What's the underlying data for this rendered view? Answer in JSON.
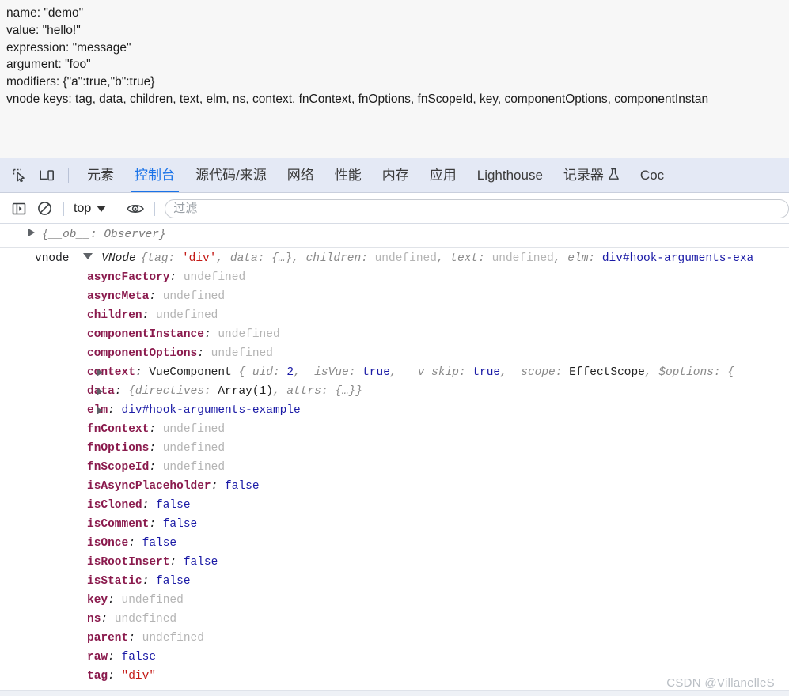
{
  "page_output": {
    "lines": [
      "name: \"demo\"",
      "value: \"hello!\"",
      "expression: \"message\"",
      "argument: \"foo\"",
      "modifiers: {\"a\":true,\"b\":true}",
      "vnode keys: tag, data, children, text, elm, ns, context, fnContext, fnOptions, fnScopeId, key, componentOptions, componentInstan"
    ]
  },
  "devtools": {
    "tabs": [
      {
        "label": "元素",
        "active": false
      },
      {
        "label": "控制台",
        "active": true
      },
      {
        "label": "源代码/来源",
        "active": false
      },
      {
        "label": "网络",
        "active": false
      },
      {
        "label": "性能",
        "active": false
      },
      {
        "label": "内存",
        "active": false
      },
      {
        "label": "应用",
        "active": false
      },
      {
        "label": "Lighthouse",
        "active": false
      },
      {
        "label": "记录器",
        "active": false,
        "has_flask": true
      },
      {
        "label": "Coc",
        "active": false
      }
    ],
    "console_toolbar": {
      "context_label": "top",
      "filter_placeholder": "过滤"
    },
    "console": {
      "observer_row": {
        "text": "{__ob__: Observer}"
      },
      "vnode_row": {
        "label": "vnode",
        "class_name": "VNode",
        "preview_parts": [
          {
            "text": "{tag: ",
            "kind": "preview"
          },
          {
            "text": "'div'",
            "kind": "string"
          },
          {
            "text": ", data: {…}, children: ",
            "kind": "preview"
          },
          {
            "text": "undefined",
            "kind": "undefined"
          },
          {
            "text": ", text: ",
            "kind": "preview"
          },
          {
            "text": "undefined",
            "kind": "undefined"
          },
          {
            "text": ", elm: ",
            "kind": "preview"
          },
          {
            "text": "div#hook-arguments-exa",
            "kind": "dom"
          }
        ]
      },
      "properties": [
        {
          "name": "asyncFactory",
          "expandable": false,
          "parts": [
            {
              "text": "undefined",
              "kind": "undefined"
            }
          ]
        },
        {
          "name": "asyncMeta",
          "expandable": false,
          "parts": [
            {
              "text": "undefined",
              "kind": "undefined"
            }
          ]
        },
        {
          "name": "children",
          "expandable": false,
          "parts": [
            {
              "text": "undefined",
              "kind": "undefined"
            }
          ]
        },
        {
          "name": "componentInstance",
          "expandable": false,
          "parts": [
            {
              "text": "undefined",
              "kind": "undefined"
            }
          ]
        },
        {
          "name": "componentOptions",
          "expandable": false,
          "parts": [
            {
              "text": "undefined",
              "kind": "undefined"
            }
          ]
        },
        {
          "name": "context",
          "expandable": true,
          "parts": [
            {
              "text": "VueComponent",
              "kind": "class"
            },
            {
              "text": "  {_uid: ",
              "kind": "preview"
            },
            {
              "text": "2",
              "kind": "number"
            },
            {
              "text": ", _isVue: ",
              "kind": "preview"
            },
            {
              "text": "true",
              "kind": "bool"
            },
            {
              "text": ", __v_skip: ",
              "kind": "preview"
            },
            {
              "text": "true",
              "kind": "bool"
            },
            {
              "text": ", _scope: ",
              "kind": "preview"
            },
            {
              "text": "EffectScope",
              "kind": "class"
            },
            {
              "text": ", $options: {",
              "kind": "preview"
            }
          ]
        },
        {
          "name": "data",
          "expandable": true,
          "parts": [
            {
              "text": "{directives: ",
              "kind": "preview"
            },
            {
              "text": "Array(1)",
              "kind": "class"
            },
            {
              "text": ", attrs: {…}}",
              "kind": "preview"
            }
          ]
        },
        {
          "name": "elm",
          "expandable": true,
          "parts": [
            {
              "text": "div#hook-arguments-example",
              "kind": "dom"
            }
          ]
        },
        {
          "name": "fnContext",
          "expandable": false,
          "parts": [
            {
              "text": "undefined",
              "kind": "undefined"
            }
          ]
        },
        {
          "name": "fnOptions",
          "expandable": false,
          "parts": [
            {
              "text": "undefined",
              "kind": "undefined"
            }
          ]
        },
        {
          "name": "fnScopeId",
          "expandable": false,
          "parts": [
            {
              "text": "undefined",
              "kind": "undefined"
            }
          ]
        },
        {
          "name": "isAsyncPlaceholder",
          "expandable": false,
          "parts": [
            {
              "text": "false",
              "kind": "bool"
            }
          ]
        },
        {
          "name": "isCloned",
          "expandable": false,
          "parts": [
            {
              "text": "false",
              "kind": "bool"
            }
          ]
        },
        {
          "name": "isComment",
          "expandable": false,
          "parts": [
            {
              "text": "false",
              "kind": "bool"
            }
          ]
        },
        {
          "name": "isOnce",
          "expandable": false,
          "parts": [
            {
              "text": "false",
              "kind": "bool"
            }
          ]
        },
        {
          "name": "isRootInsert",
          "expandable": false,
          "parts": [
            {
              "text": "false",
              "kind": "bool"
            }
          ]
        },
        {
          "name": "isStatic",
          "expandable": false,
          "parts": [
            {
              "text": "false",
              "kind": "bool"
            }
          ]
        },
        {
          "name": "key",
          "expandable": false,
          "parts": [
            {
              "text": "undefined",
              "kind": "undefined"
            }
          ]
        },
        {
          "name": "ns",
          "expandable": false,
          "parts": [
            {
              "text": "undefined",
              "kind": "undefined"
            }
          ]
        },
        {
          "name": "parent",
          "expandable": false,
          "parts": [
            {
              "text": "undefined",
              "kind": "undefined"
            }
          ]
        },
        {
          "name": "raw",
          "expandable": false,
          "parts": [
            {
              "text": "false",
              "kind": "bool"
            }
          ]
        },
        {
          "name": "tag",
          "expandable": false,
          "parts": [
            {
              "text": "\"div\"",
              "kind": "string"
            }
          ]
        }
      ]
    }
  },
  "watermark": "CSDN @VillanelleS",
  "colors": {
    "tabbar_bg": "#e4e9f5",
    "accent": "#1a73e8",
    "string": "#c41a16",
    "number": "#1a1aa6",
    "property": "#8a1a4d",
    "undefined": "#b4b4b4"
  }
}
